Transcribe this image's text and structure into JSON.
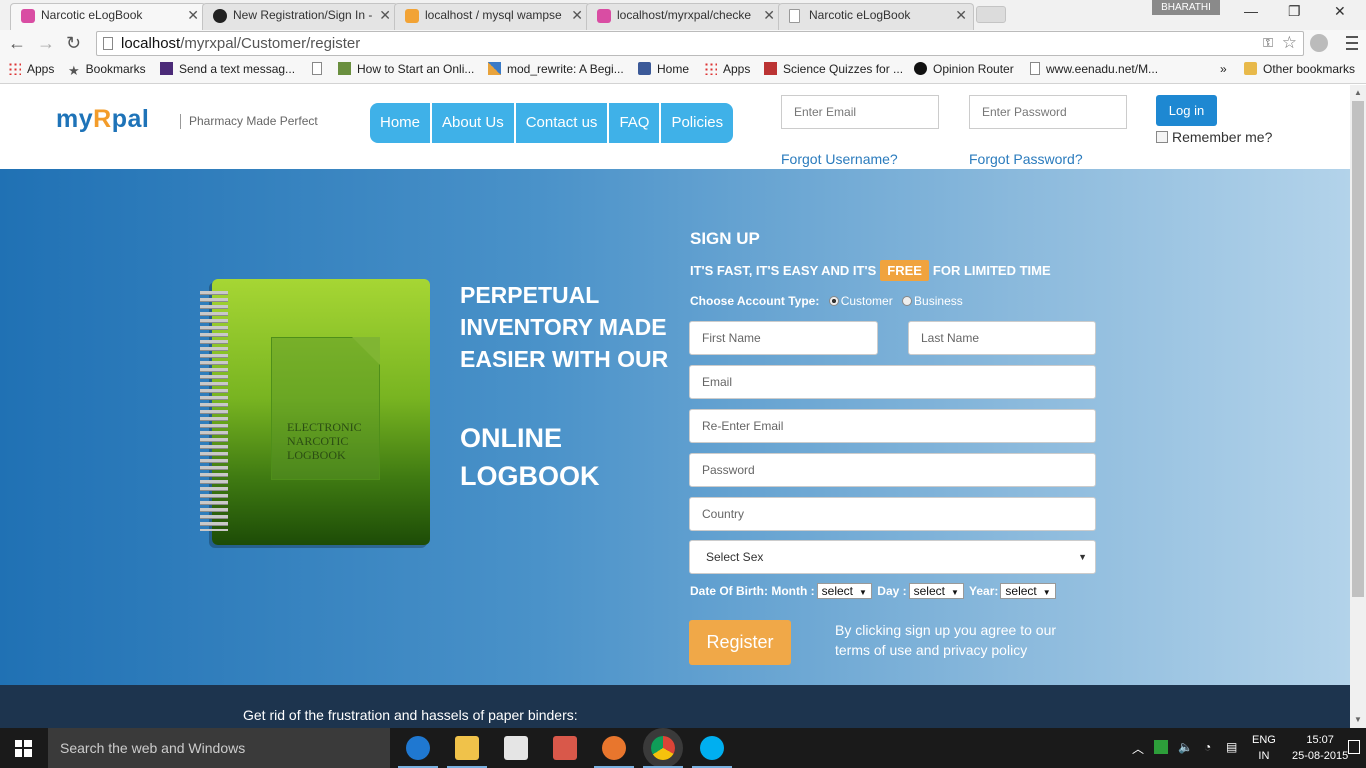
{
  "browser": {
    "tabs": [
      {
        "title": "Narcotic eLogBook",
        "icon": "myrxpal-favicon",
        "active": true
      },
      {
        "title": "New Registration/Sign In -",
        "icon": "github-favicon"
      },
      {
        "title": "localhost / mysql wampse",
        "icon": "phpmyadmin-favicon"
      },
      {
        "title": "localhost/myrxpal/checke",
        "icon": "myrxpal-favicon"
      },
      {
        "title": "Narcotic eLogBook",
        "icon": "page-favicon"
      }
    ],
    "profile_name": "BHARATHI",
    "url_host": "localhost",
    "url_path": "/myrxpal/Customer/register",
    "bookmarks": [
      {
        "label": "Apps",
        "icon": "apps-icon"
      },
      {
        "label": "Bookmarks",
        "icon": "star-icon"
      },
      {
        "label": "Send a text messag...",
        "icon": "ytd-icon"
      },
      {
        "label": "",
        "icon": "page-icon"
      },
      {
        "label": "How to Start an Onli...",
        "icon": "wikihow-icon"
      },
      {
        "label": "mod_rewrite: A Begi...",
        "icon": "sitepoint-icon"
      },
      {
        "label": "Home",
        "icon": "facebook-icon"
      },
      {
        "label": "Apps",
        "icon": "apps-icon"
      },
      {
        "label": "Science Quizzes for ...",
        "icon": "sporcle-icon"
      },
      {
        "label": "Opinion Router",
        "icon": "opinion-router-icon"
      },
      {
        "label": "www.eenadu.net/M...",
        "icon": "page-icon"
      }
    ],
    "bookmarks_overflow": "»",
    "other_bookmarks": "Other bookmarks"
  },
  "site": {
    "logo_my": "my",
    "logo_rx": "R",
    "logo_pal": "pal",
    "tagline": "Pharmacy Made Perfect",
    "nav": [
      "Home",
      "About Us",
      "Contact us",
      "FAQ",
      "Policies"
    ],
    "login": {
      "email_placeholder": "Enter Email",
      "password_placeholder": "Enter Password",
      "button": "Log in",
      "remember": "Remember me?",
      "forgot_username": "Forgot Username?",
      "forgot_password": "Forgot Password?"
    }
  },
  "hero": {
    "notebook_text": "ELECTRONIC NARCOTIC LOGBOOK",
    "title": "PERPETUAL INVENTORY MADE EASIER WITH OUR",
    "subtitle": "ONLINE LOGBOOK"
  },
  "signup": {
    "title": "SIGN UP",
    "tag_before": "IT'S FAST, IT'S EASY AND IT'S",
    "tag_badge": "FREE",
    "tag_after": "FOR LIMITED TIME",
    "account_type_label": "Choose Account Type:",
    "account_types": [
      "Customer",
      "Business"
    ],
    "selected_account_type": "Customer",
    "placeholders": {
      "first_name": "First Name",
      "last_name": "Last Name",
      "email": "Email",
      "re_email": "Re-Enter Email",
      "password": "Password",
      "country": "Country"
    },
    "sex_select": "Select Sex",
    "dob_label": "Date Of Birth:",
    "dob_month_label": "Month :",
    "dob_day_label": "Day :",
    "dob_year_label": "Year:",
    "dob_select": "select",
    "register_button": "Register",
    "agree_text": "By clicking sign up you agree to our terms of use and privacy policy"
  },
  "footer": {
    "text": "Get rid of the frustration and hassels of paper binders:"
  },
  "taskbar": {
    "search_placeholder": "Search the web and Windows",
    "apps": [
      "edge-icon",
      "file-explorer-icon",
      "store-icon",
      "paint-icon",
      "firefox-icon",
      "chrome-icon",
      "skype-icon"
    ],
    "lang_line1": "ENG",
    "lang_line2": "IN",
    "time": "15:07",
    "date": "25-08-2015"
  },
  "colors": {
    "nav_blue": "#3fb1e8",
    "login_blue": "#1e88d2",
    "accent_orange": "#f0a848",
    "hero_left": "#2071b4",
    "hero_right": "#b3d3ea",
    "footer_dark": "#1d344e"
  }
}
